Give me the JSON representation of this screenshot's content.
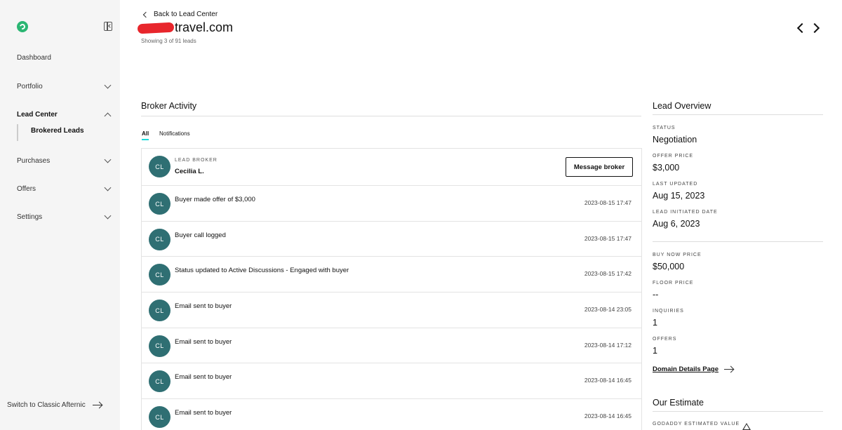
{
  "sidebar": {
    "nav": {
      "dashboard": "Dashboard",
      "portfolio": "Portfolio",
      "lead_center": "Lead Center",
      "brokered_leads": "Brokered Leads",
      "purchases": "Purchases",
      "offers": "Offers",
      "settings": "Settings"
    },
    "switch_classic": "Switch to Classic Afternic"
  },
  "header": {
    "back_label": "Back to Lead Center",
    "domain_visible": "travel.com",
    "showing": "Showing 3 of 91 leads"
  },
  "broker_activity": {
    "title": "Broker Activity",
    "tabs": {
      "all": "All",
      "notifications": "Notifications"
    },
    "lead_broker": {
      "initials": "CL",
      "label": "LEAD BROKER",
      "name": "Cecilia L.",
      "message_button": "Message broker"
    },
    "events": [
      {
        "initials": "CL",
        "text": "Buyer made offer of $3,000",
        "time": "2023-08-15 17:47"
      },
      {
        "initials": "CL",
        "text": "Buyer call logged",
        "time": "2023-08-15 17:47"
      },
      {
        "initials": "CL",
        "text": "Status updated to Active Discussions - Engaged with buyer",
        "time": "2023-08-15 17:42"
      },
      {
        "initials": "CL",
        "text": "Email sent to buyer",
        "time": "2023-08-14 23:05"
      },
      {
        "initials": "CL",
        "text": "Email sent to buyer",
        "time": "2023-08-14 17:12"
      },
      {
        "initials": "CL",
        "text": "Email sent to buyer",
        "time": "2023-08-14 16:45"
      },
      {
        "initials": "CL",
        "text": "Email sent to buyer",
        "time": "2023-08-14 16:45"
      }
    ]
  },
  "lead_overview": {
    "title": "Lead Overview",
    "status_label": "STATUS",
    "status": "Negotiation",
    "offer_price_label": "OFFER PRICE",
    "offer_price": "$3,000",
    "last_updated_label": "LAST UPDATED",
    "last_updated": "Aug 15, 2023",
    "initiated_label": "LEAD INITIATED DATE",
    "initiated": "Aug 6, 2023",
    "buy_now_label": "BUY NOW PRICE",
    "buy_now": "$50,000",
    "floor_label": "FLOOR PRICE",
    "floor": "--",
    "inquiries_label": "INQUIRIES",
    "inquiries": "1",
    "offers_label": "OFFERS",
    "offers": "1",
    "domain_details_link": "Domain Details Page"
  },
  "our_estimate": {
    "title": "Our Estimate",
    "godaddy_label": "GODADDY ESTIMATED VALUE"
  },
  "colors": {
    "avatar": "#2f6f73",
    "tab_underline": "#1bdbdb",
    "redaction": "#e8262c",
    "logo": "#2bb673"
  }
}
